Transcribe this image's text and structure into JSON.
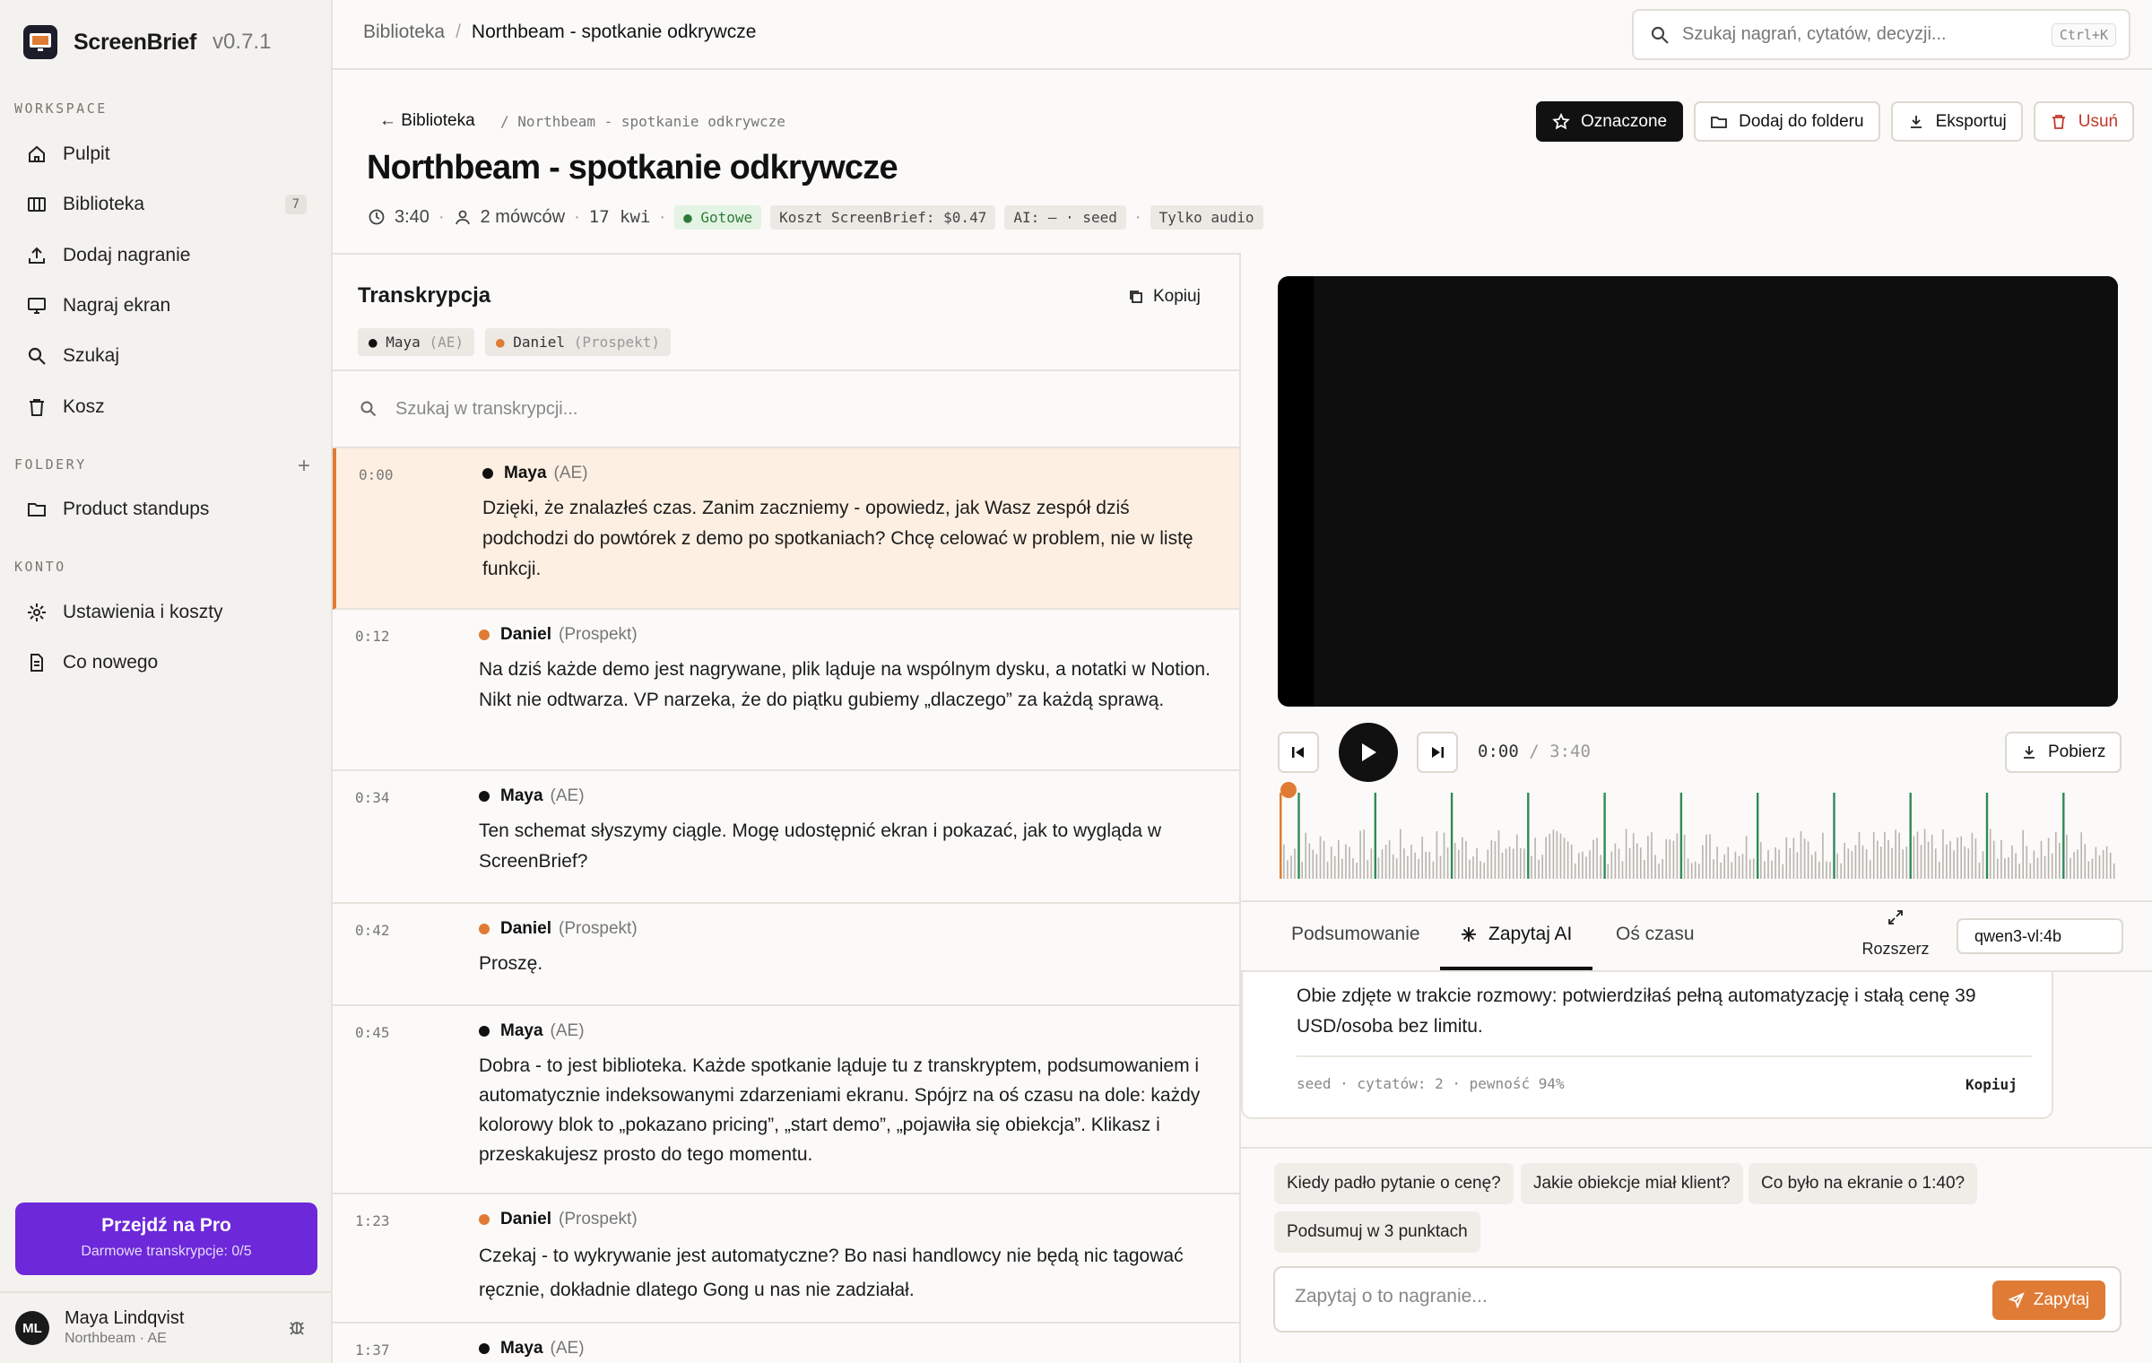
{
  "app": {
    "name": "ScreenBrief",
    "version": "v0.7.1"
  },
  "sidebar": {
    "workspace_label": "WORKSPACE",
    "items": [
      {
        "label": "Pulpit",
        "icon": "home-icon"
      },
      {
        "label": "Biblioteka",
        "icon": "library-icon",
        "badge": "7"
      },
      {
        "label": "Dodaj nagranie",
        "icon": "upload-icon"
      },
      {
        "label": "Nagraj ekran",
        "icon": "monitor-icon"
      },
      {
        "label": "Szukaj",
        "icon": "search-icon"
      },
      {
        "label": "Kosz",
        "icon": "trash-icon"
      }
    ],
    "folders_label": "FOLDERY",
    "folders": [
      {
        "label": "Product standups",
        "icon": "folder-icon"
      }
    ],
    "account_label": "KONTO",
    "account_items": [
      {
        "label": "Ustawienia i koszty",
        "icon": "settings-icon"
      },
      {
        "label": "Co nowego",
        "icon": "document-icon"
      }
    ],
    "pro": {
      "title": "Przejdź na Pro",
      "subtitle": "Darmowe transkrypcje: 0/5",
      "color": "#6d28d9"
    },
    "user": {
      "initials": "ML",
      "name": "Maya Lindqvist",
      "org": "Northbeam · AE"
    }
  },
  "topbar": {
    "breadcrumb": [
      "Biblioteka",
      "/",
      "Northbeam - spotkanie odkrywcze"
    ],
    "search_placeholder": "Szukaj nagrań, cytatów, decyzji...",
    "shortcut": "Ctrl+K"
  },
  "header": {
    "back": "← Biblioteka",
    "path": "/ Northbeam - spotkanie odkrywcze",
    "title": "Northbeam - spotkanie odkrywcze",
    "duration": "3:40",
    "speakers": "2 mówców",
    "date": "17 kwi",
    "status": "Gotowe",
    "cost": "Koszt ScreenBrief: $0.47",
    "ai": "AI: – · seed",
    "mode": "Tylko audio",
    "actions": {
      "marked": "Oznaczone",
      "add_folder": "Dodaj do folderu",
      "export": "Eksportuj",
      "delete": "Usuń"
    }
  },
  "transcript": {
    "title": "Transkrypcja",
    "copy": "Kopiuj",
    "speakers": [
      {
        "name": "Maya",
        "role": "(AE)",
        "color": "#111111"
      },
      {
        "name": "Daniel",
        "role": "(Prospekt)",
        "color": "#e07b35"
      }
    ],
    "search_placeholder": "Szukaj w transkrypcji...",
    "segments": [
      {
        "time": "0:00",
        "speaker": "Maya",
        "role": "(AE)",
        "color": "#111111",
        "text": "Dzięki, że znalazłeś czas. Zanim zaczniemy - opowiedz, jak Wasz zespół dziś podchodzi do powtórek z demo po spotkaniach? Chcę celować w problem, nie w listę funkcji."
      },
      {
        "time": "0:12",
        "speaker": "Daniel",
        "role": "(Prospekt)",
        "color": "#e07b35",
        "text": "Na dziś każde demo jest nagrywane, plik ląduje na wspólnym dysku, a notatki w Notion. Nikt nie odtwarza. VP narzeka, że do piątku gubiemy „dlaczego” za każdą sprawą."
      },
      {
        "time": "0:34",
        "speaker": "Maya",
        "role": "(AE)",
        "color": "#111111",
        "text": "Ten schemat słyszymy ciągle. Mogę udostępnić ekran i pokazać, jak to wygląda w ScreenBrief?"
      },
      {
        "time": "0:42",
        "speaker": "Daniel",
        "role": "(Prospekt)",
        "color": "#e07b35",
        "text": "Proszę."
      },
      {
        "time": "0:45",
        "speaker": "Maya",
        "role": "(AE)",
        "color": "#111111",
        "text": "Dobra - to jest biblioteka. Każde spotkanie ląduje tu z transkryptem, podsumowaniem i automatycznie indeksowanymi zdarzeniami ekranu. Spójrz na oś czasu na dole: każdy kolorowy blok to „pokazano pricing”, „start demo”, „pojawiła się obiekcja”. Klikasz i przeskakujesz prosto do tego momentu."
      },
      {
        "time": "1:23",
        "speaker": "Daniel",
        "role": "(Prospekt)",
        "color": "#e07b35",
        "text": "Czekaj - to wykrywanie jest automatyczne? Bo nasi handlowcy nie będą nic tagować ręcznie, dokładnie dlatego Gong u nas nie zadziałał."
      },
      {
        "time": "1:37",
        "speaker": "Maya",
        "role": "(AE)",
        "color": "#111111",
        "text": ""
      }
    ]
  },
  "player": {
    "current": "0:00",
    "separator": "/",
    "total": "3:40",
    "progress": 0,
    "download": "Pobierz",
    "marker_colors": [
      "#e07b35",
      "#555555",
      "#2e8b57"
    ]
  },
  "ai_panel": {
    "tabs": [
      "Podsumowanie",
      "Zapytaj AI",
      "Oś czasu"
    ],
    "active_tab": "Zapytaj AI",
    "expand": "Rozszerz",
    "model": "qwen3-vl:4b",
    "answer": "Obie zdjęte w trakcie rozmowy: potwierdziłaś pełną automatyzację i stałą cenę 39 USD/osoba bez limitu.",
    "answer_meta": "seed · cytatów: 2 · pewność 94%",
    "answer_copy": "Kopiuj",
    "suggestions": [
      "Kiedy padło pytanie o cenę?",
      "Jakie obiekcje miał klient?",
      "Co było na ekranie o 1:40?",
      "Podsumuj w 3 punktach"
    ],
    "ask_placeholder": "Zapytaj o to nagranie...",
    "ask_button": "Zapytaj",
    "accent": "#e07b35"
  }
}
